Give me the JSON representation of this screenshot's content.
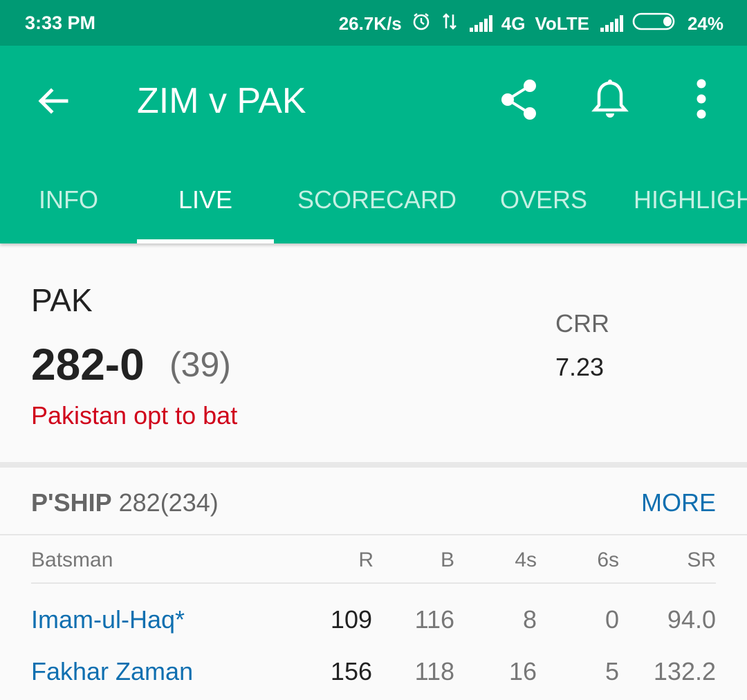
{
  "status_bar": {
    "time": "3:33 PM",
    "network_speed": "26.7K/s",
    "network_type": "4G",
    "volte": "VoLTE",
    "battery": "24%"
  },
  "app_bar": {
    "title": "ZIM v PAK",
    "actions": [
      "back-arrow-icon",
      "share-icon",
      "bell-icon",
      "more-vert-icon"
    ]
  },
  "tabs": [
    {
      "label": "INFO",
      "active": false
    },
    {
      "label": "LIVE",
      "active": true
    },
    {
      "label": "SCORECARD",
      "active": false
    },
    {
      "label": "OVERS",
      "active": false
    },
    {
      "label": "HIGHLIGHTS",
      "active": false
    }
  ],
  "score": {
    "team": "PAK",
    "runs_wickets": "282-0",
    "overs": "(39)",
    "status": "Pakistan opt to bat",
    "crr_label": "CRR",
    "crr_value": "7.23"
  },
  "partnership": {
    "label": "P'SHIP",
    "value": "282(234)",
    "more": "MORE"
  },
  "batting": {
    "headers": [
      "Batsman",
      "R",
      "B",
      "4s",
      "6s",
      "SR"
    ],
    "rows": [
      [
        "Imam-ul-Haq*",
        "109",
        "116",
        "8",
        "0",
        "94.0"
      ],
      [
        "Fakhar Zaman",
        "156",
        "118",
        "16",
        "5",
        "132.2"
      ]
    ]
  },
  "colors": {
    "status_bar": "#009a74",
    "app_bar": "#00b68a",
    "link_blue": "#0f6fb0",
    "status_red": "#d0021b"
  }
}
